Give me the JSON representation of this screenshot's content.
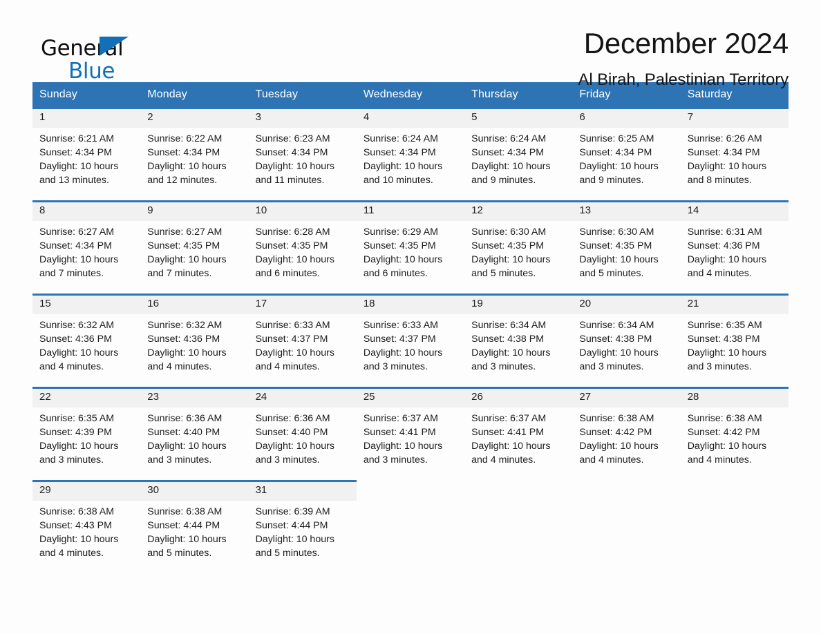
{
  "brand": {
    "name_top": "General",
    "name_bottom": "Blue",
    "accent_color": "#1270b8"
  },
  "header": {
    "title": "December 2024",
    "subtitle": "Al Birah, Palestinian Territory"
  },
  "theme": {
    "header_blue": "#2e74b5",
    "date_band_gray": "#f1f1f1",
    "page_background": "#fdfdfd"
  },
  "calendar": {
    "weekday_headers": [
      "Sunday",
      "Monday",
      "Tuesday",
      "Wednesday",
      "Thursday",
      "Friday",
      "Saturday"
    ],
    "weeks": [
      [
        {
          "day": "1",
          "sunrise": "Sunrise: 6:21 AM",
          "sunset": "Sunset: 4:34 PM",
          "daylight_line1": "Daylight: 10 hours",
          "daylight_line2": "and 13 minutes."
        },
        {
          "day": "2",
          "sunrise": "Sunrise: 6:22 AM",
          "sunset": "Sunset: 4:34 PM",
          "daylight_line1": "Daylight: 10 hours",
          "daylight_line2": "and 12 minutes."
        },
        {
          "day": "3",
          "sunrise": "Sunrise: 6:23 AM",
          "sunset": "Sunset: 4:34 PM",
          "daylight_line1": "Daylight: 10 hours",
          "daylight_line2": "and 11 minutes."
        },
        {
          "day": "4",
          "sunrise": "Sunrise: 6:24 AM",
          "sunset": "Sunset: 4:34 PM",
          "daylight_line1": "Daylight: 10 hours",
          "daylight_line2": "and 10 minutes."
        },
        {
          "day": "5",
          "sunrise": "Sunrise: 6:24 AM",
          "sunset": "Sunset: 4:34 PM",
          "daylight_line1": "Daylight: 10 hours",
          "daylight_line2": "and 9 minutes."
        },
        {
          "day": "6",
          "sunrise": "Sunrise: 6:25 AM",
          "sunset": "Sunset: 4:34 PM",
          "daylight_line1": "Daylight: 10 hours",
          "daylight_line2": "and 9 minutes."
        },
        {
          "day": "7",
          "sunrise": "Sunrise: 6:26 AM",
          "sunset": "Sunset: 4:34 PM",
          "daylight_line1": "Daylight: 10 hours",
          "daylight_line2": "and 8 minutes."
        }
      ],
      [
        {
          "day": "8",
          "sunrise": "Sunrise: 6:27 AM",
          "sunset": "Sunset: 4:34 PM",
          "daylight_line1": "Daylight: 10 hours",
          "daylight_line2": "and 7 minutes."
        },
        {
          "day": "9",
          "sunrise": "Sunrise: 6:27 AM",
          "sunset": "Sunset: 4:35 PM",
          "daylight_line1": "Daylight: 10 hours",
          "daylight_line2": "and 7 minutes."
        },
        {
          "day": "10",
          "sunrise": "Sunrise: 6:28 AM",
          "sunset": "Sunset: 4:35 PM",
          "daylight_line1": "Daylight: 10 hours",
          "daylight_line2": "and 6 minutes."
        },
        {
          "day": "11",
          "sunrise": "Sunrise: 6:29 AM",
          "sunset": "Sunset: 4:35 PM",
          "daylight_line1": "Daylight: 10 hours",
          "daylight_line2": "and 6 minutes."
        },
        {
          "day": "12",
          "sunrise": "Sunrise: 6:30 AM",
          "sunset": "Sunset: 4:35 PM",
          "daylight_line1": "Daylight: 10 hours",
          "daylight_line2": "and 5 minutes."
        },
        {
          "day": "13",
          "sunrise": "Sunrise: 6:30 AM",
          "sunset": "Sunset: 4:35 PM",
          "daylight_line1": "Daylight: 10 hours",
          "daylight_line2": "and 5 minutes."
        },
        {
          "day": "14",
          "sunrise": "Sunrise: 6:31 AM",
          "sunset": "Sunset: 4:36 PM",
          "daylight_line1": "Daylight: 10 hours",
          "daylight_line2": "and 4 minutes."
        }
      ],
      [
        {
          "day": "15",
          "sunrise": "Sunrise: 6:32 AM",
          "sunset": "Sunset: 4:36 PM",
          "daylight_line1": "Daylight: 10 hours",
          "daylight_line2": "and 4 minutes."
        },
        {
          "day": "16",
          "sunrise": "Sunrise: 6:32 AM",
          "sunset": "Sunset: 4:36 PM",
          "daylight_line1": "Daylight: 10 hours",
          "daylight_line2": "and 4 minutes."
        },
        {
          "day": "17",
          "sunrise": "Sunrise: 6:33 AM",
          "sunset": "Sunset: 4:37 PM",
          "daylight_line1": "Daylight: 10 hours",
          "daylight_line2": "and 4 minutes."
        },
        {
          "day": "18",
          "sunrise": "Sunrise: 6:33 AM",
          "sunset": "Sunset: 4:37 PM",
          "daylight_line1": "Daylight: 10 hours",
          "daylight_line2": "and 3 minutes."
        },
        {
          "day": "19",
          "sunrise": "Sunrise: 6:34 AM",
          "sunset": "Sunset: 4:38 PM",
          "daylight_line1": "Daylight: 10 hours",
          "daylight_line2": "and 3 minutes."
        },
        {
          "day": "20",
          "sunrise": "Sunrise: 6:34 AM",
          "sunset": "Sunset: 4:38 PM",
          "daylight_line1": "Daylight: 10 hours",
          "daylight_line2": "and 3 minutes."
        },
        {
          "day": "21",
          "sunrise": "Sunrise: 6:35 AM",
          "sunset": "Sunset: 4:38 PM",
          "daylight_line1": "Daylight: 10 hours",
          "daylight_line2": "and 3 minutes."
        }
      ],
      [
        {
          "day": "22",
          "sunrise": "Sunrise: 6:35 AM",
          "sunset": "Sunset: 4:39 PM",
          "daylight_line1": "Daylight: 10 hours",
          "daylight_line2": "and 3 minutes."
        },
        {
          "day": "23",
          "sunrise": "Sunrise: 6:36 AM",
          "sunset": "Sunset: 4:40 PM",
          "daylight_line1": "Daylight: 10 hours",
          "daylight_line2": "and 3 minutes."
        },
        {
          "day": "24",
          "sunrise": "Sunrise: 6:36 AM",
          "sunset": "Sunset: 4:40 PM",
          "daylight_line1": "Daylight: 10 hours",
          "daylight_line2": "and 3 minutes."
        },
        {
          "day": "25",
          "sunrise": "Sunrise: 6:37 AM",
          "sunset": "Sunset: 4:41 PM",
          "daylight_line1": "Daylight: 10 hours",
          "daylight_line2": "and 3 minutes."
        },
        {
          "day": "26",
          "sunrise": "Sunrise: 6:37 AM",
          "sunset": "Sunset: 4:41 PM",
          "daylight_line1": "Daylight: 10 hours",
          "daylight_line2": "and 4 minutes."
        },
        {
          "day": "27",
          "sunrise": "Sunrise: 6:38 AM",
          "sunset": "Sunset: 4:42 PM",
          "daylight_line1": "Daylight: 10 hours",
          "daylight_line2": "and 4 minutes."
        },
        {
          "day": "28",
          "sunrise": "Sunrise: 6:38 AM",
          "sunset": "Sunset: 4:42 PM",
          "daylight_line1": "Daylight: 10 hours",
          "daylight_line2": "and 4 minutes."
        }
      ],
      [
        {
          "day": "29",
          "sunrise": "Sunrise: 6:38 AM",
          "sunset": "Sunset: 4:43 PM",
          "daylight_line1": "Daylight: 10 hours",
          "daylight_line2": "and 4 minutes."
        },
        {
          "day": "30",
          "sunrise": "Sunrise: 6:38 AM",
          "sunset": "Sunset: 4:44 PM",
          "daylight_line1": "Daylight: 10 hours",
          "daylight_line2": "and 5 minutes."
        },
        {
          "day": "31",
          "sunrise": "Sunrise: 6:39 AM",
          "sunset": "Sunset: 4:44 PM",
          "daylight_line1": "Daylight: 10 hours",
          "daylight_line2": "and 5 minutes."
        },
        {
          "day": "",
          "sunrise": "",
          "sunset": "",
          "daylight_line1": "",
          "daylight_line2": ""
        },
        {
          "day": "",
          "sunrise": "",
          "sunset": "",
          "daylight_line1": "",
          "daylight_line2": ""
        },
        {
          "day": "",
          "sunrise": "",
          "sunset": "",
          "daylight_line1": "",
          "daylight_line2": ""
        },
        {
          "day": "",
          "sunrise": "",
          "sunset": "",
          "daylight_line1": "",
          "daylight_line2": ""
        }
      ]
    ]
  }
}
